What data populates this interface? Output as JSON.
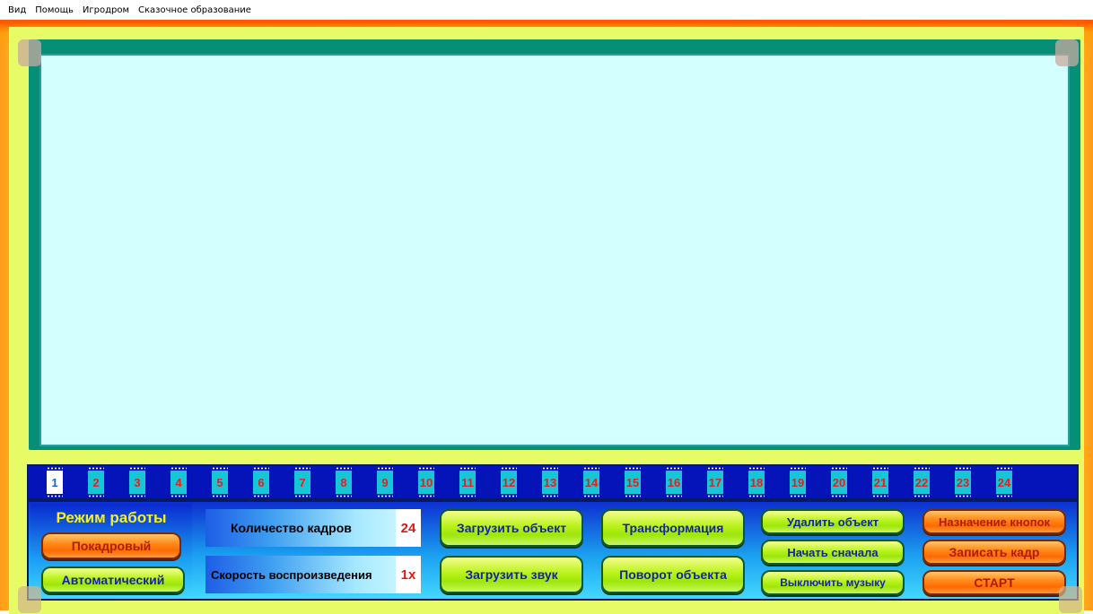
{
  "menu": [
    "Вид",
    "Помощь",
    "Игродром",
    "Сказочное образование"
  ],
  "filmstrip": {
    "active_index": 0,
    "frames": [
      "1",
      "2",
      "3",
      "4",
      "5",
      "6",
      "7",
      "8",
      "9",
      "10",
      "11",
      "12",
      "13",
      "14",
      "15",
      "16",
      "17",
      "18",
      "19",
      "20",
      "21",
      "22",
      "23",
      "24"
    ]
  },
  "mode": {
    "title": "Режим работы",
    "frame_by_frame": "Покадровый",
    "automatic": "Автоматический"
  },
  "frame_count": {
    "label": "Количество кадров",
    "value": "24"
  },
  "playback_speed": {
    "label": "Скорость воспроизведения",
    "value": "1x"
  },
  "actions": {
    "load_object": "Загрузить объект",
    "load_sound": "Загрузить звук",
    "transform": "Трансформация",
    "rotate_object": "Поворот объекта",
    "delete_object": "Удалить объект",
    "start_over": "Начать сначала",
    "music_off": "Выключить музыку",
    "assign_buttons": "Назначение кнопок",
    "record_frame": "Записать кадр",
    "start": "СТАРТ"
  },
  "colors": {
    "frame_outer": "#ff9a1a",
    "frame_inner": "#e6fb66",
    "stage_border": "#068f76",
    "stage": "#d4ffff",
    "filmstrip": "#0414b8",
    "frame_cell": "#15c6d6",
    "frame_number": "#e22020"
  }
}
